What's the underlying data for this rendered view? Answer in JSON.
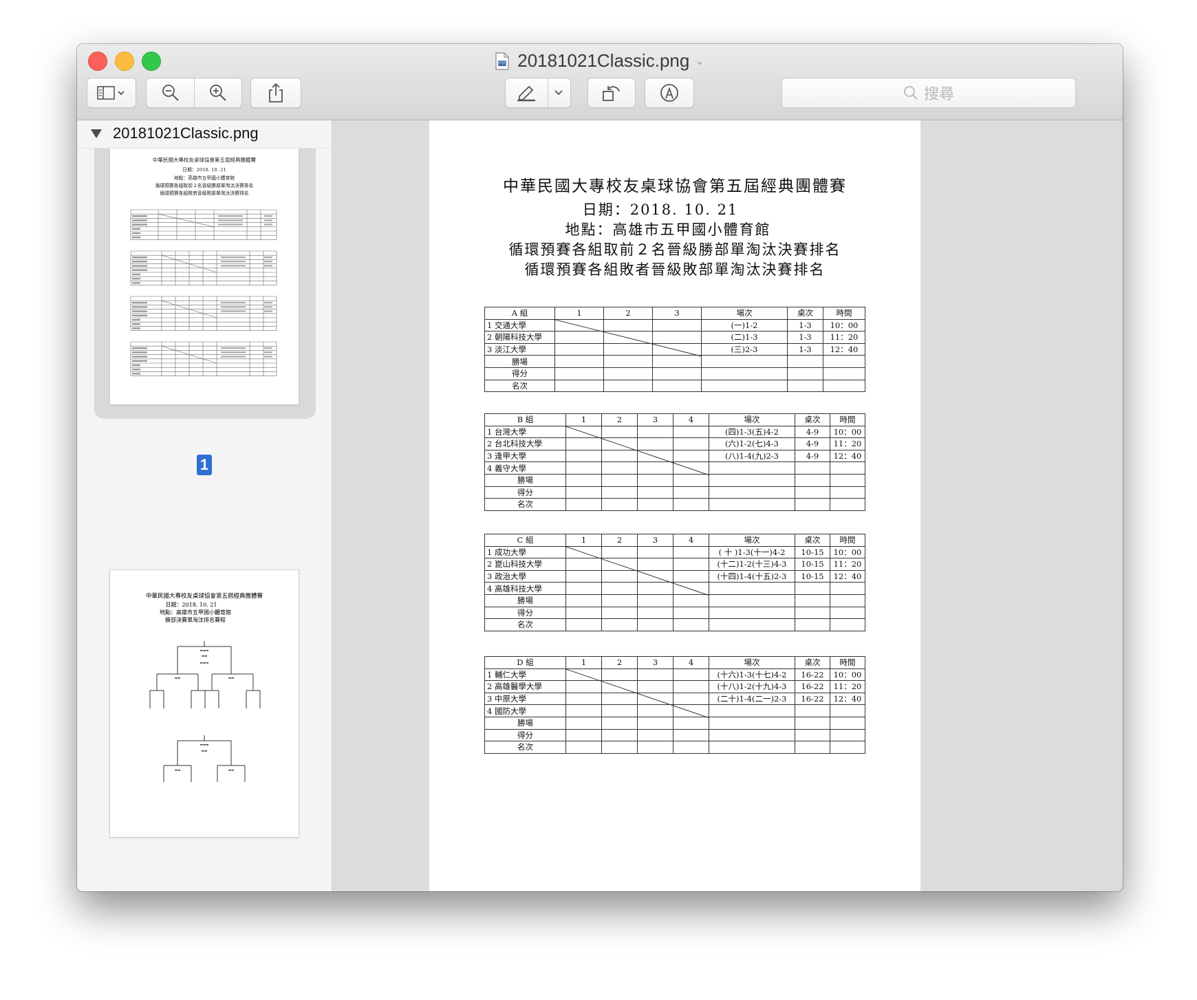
{
  "window": {
    "title": "20181021Classic.png",
    "search_placeholder": "搜尋"
  },
  "toolbar": {
    "sidebar_button": "sidebar-toggle",
    "zoom_out": "zoom-out",
    "zoom_in": "zoom-in",
    "share": "share",
    "markup": "markup",
    "rotate": "rotate",
    "annotate": "annotate"
  },
  "sidebar": {
    "file_name": "20181021Classic.png",
    "page_number": "1"
  },
  "document": {
    "title": "中華民國大專校友桌球協會第五屆經典團體賽",
    "date": "日期：2018. 10. 21",
    "venue": "地點：高雄市五甲國小體育館",
    "rule1": "循環預賽各組取前２名晉級勝部單淘汰決賽排名",
    "rule2": "循環預賽各組敗者晉級敗部單淘汰決賽排名",
    "groups": [
      {
        "label": "A 組",
        "cols": [
          "1",
          "2",
          "3"
        ],
        "teams": [
          "1 交通大學",
          "2 朝陽科技大學",
          "3 淡江大學"
        ],
        "matches": [
          "(一)1-2",
          "(二)1-3",
          "(三)2-3"
        ],
        "tables": [
          "1-3",
          "1-3",
          "1-3"
        ],
        "times": [
          "10：00",
          "11：20",
          "12：40"
        ],
        "match_header": "場次",
        "table_header": "桌次",
        "time_header": "時間",
        "foot": [
          "勝場",
          "得分",
          "名次"
        ]
      },
      {
        "label": "B 組",
        "cols": [
          "1",
          "2",
          "3",
          "4"
        ],
        "teams": [
          "1 台灣大學",
          "2 台北科技大學",
          "3 逢甲大學",
          "4 義守大學"
        ],
        "matches": [
          "(四)1-3(五)4-2",
          "(六)1-2(七)4-3",
          "(八)1-4(九)2-3",
          ""
        ],
        "tables": [
          "4-9",
          "4-9",
          "4-9",
          ""
        ],
        "times": [
          "10：00",
          "11：20",
          "12：40",
          ""
        ],
        "match_header": "場次",
        "table_header": "桌次",
        "time_header": "時間",
        "foot": [
          "勝場",
          "得分",
          "名次"
        ]
      },
      {
        "label": "C 組",
        "cols": [
          "1",
          "2",
          "3",
          "4"
        ],
        "teams": [
          "1 成功大學",
          "2 崑山科技大學",
          "3 政治大學",
          "4 高雄科技大學"
        ],
        "matches": [
          "( 十 )1-3(十一)4-2",
          "(十二)1-2(十三)4-3",
          "(十四)1-4(十五)2-3",
          ""
        ],
        "tables": [
          "10-15",
          "10-15",
          "10-15",
          ""
        ],
        "times": [
          "10：00",
          "11：20",
          "12：40",
          ""
        ],
        "match_header": "場次",
        "table_header": "桌次",
        "time_header": "時間",
        "foot": [
          "勝場",
          "得分",
          "名次"
        ]
      },
      {
        "label": "D 組",
        "cols": [
          "1",
          "2",
          "3",
          "4"
        ],
        "teams": [
          "1 輔仁大學",
          "2 高雄醫學大學",
          "3 中原大學",
          "4 國防大學"
        ],
        "matches": [
          "(十六)1-3(十七)4-2",
          "(十八)1-2(十九)4-3",
          "(二十)1-4(二一)2-3",
          ""
        ],
        "tables": [
          "16-22",
          "16-22",
          "16-22",
          ""
        ],
        "times": [
          "10：00",
          "11：20",
          "12：40",
          ""
        ],
        "match_header": "場次",
        "table_header": "桌次",
        "time_header": "時間",
        "foot": [
          "勝場",
          "得分",
          "名次"
        ]
      }
    ]
  },
  "page2_thumb": {
    "title": "中華民國大專校友桌球協會第五屆經典團體賽",
    "date": "日期：2018. 10. 21",
    "venue": "地點：高雄市五甲國小體育館",
    "rule": "勝部決賽單淘汰排名賽程"
  }
}
